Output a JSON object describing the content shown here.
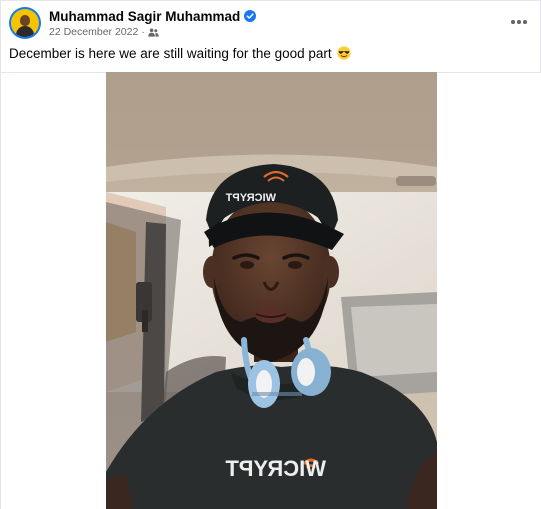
{
  "post": {
    "author": "Muhammad Sagir Muhammad",
    "date": "22 December 2022",
    "separator": "·",
    "caption": "December is here we are still waiting for the good part",
    "caption_emoji": "smiling-face-with-sunglasses-emoji",
    "audience_icon": "friends-icon",
    "verified_icon": "verified-badge-icon",
    "more_icon": "more-options-icon"
  },
  "photo": {
    "cap_logo": "WICRYPT",
    "shirt_logo": "WICRYPT"
  },
  "colors": {
    "verified": "#1877f2",
    "meta_text": "#65676b",
    "primary_text": "#050505",
    "shirt": "#2a2d2d",
    "headphones": "#8cb7d8"
  }
}
